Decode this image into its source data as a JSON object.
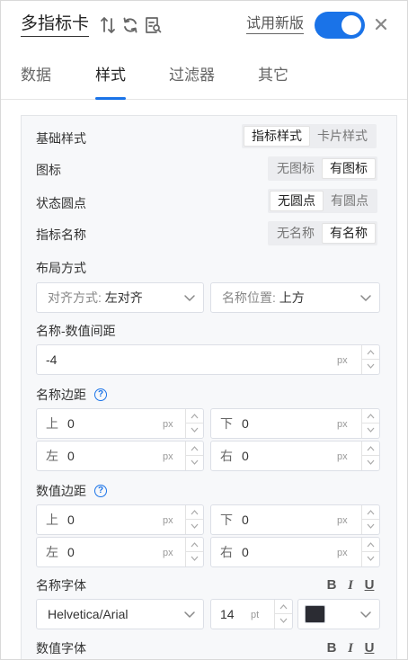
{
  "header": {
    "title": "多指标卡",
    "try_new_label": "试用新版",
    "toggle_on": true,
    "icons": [
      "sort-icon",
      "refresh-icon",
      "preview-icon",
      "close-icon"
    ]
  },
  "tabs": [
    {
      "label": "数据",
      "active": false
    },
    {
      "label": "样式",
      "active": true
    },
    {
      "label": "过滤器",
      "active": false
    },
    {
      "label": "其它",
      "active": false
    }
  ],
  "style": {
    "base_style": {
      "label": "基础样式",
      "options": [
        "指标样式",
        "卡片样式"
      ],
      "selected": "指标样式"
    },
    "icon": {
      "label": "图标",
      "options": [
        "无图标",
        "有图标"
      ],
      "selected": "有图标"
    },
    "status_dot": {
      "label": "状态圆点",
      "options": [
        "无圆点",
        "有圆点"
      ],
      "selected": "无圆点"
    },
    "metric_name": {
      "label": "指标名称",
      "options": [
        "无名称",
        "有名称"
      ],
      "selected": "有名称"
    },
    "layout": {
      "label": "布局方式",
      "align_prefix": "对齐方式:",
      "align_value": "左对齐",
      "name_pos_prefix": "名称位置:",
      "name_pos_value": "上方"
    },
    "name_value_gap": {
      "label": "名称-数值间距",
      "value": "-4",
      "unit": "px"
    },
    "name_margin": {
      "label": "名称边距",
      "top": {
        "prefix": "上",
        "value": "0",
        "unit": "px"
      },
      "bottom": {
        "prefix": "下",
        "value": "0",
        "unit": "px"
      },
      "left": {
        "prefix": "左",
        "value": "0",
        "unit": "px"
      },
      "right": {
        "prefix": "右",
        "value": "0",
        "unit": "px"
      }
    },
    "value_margin": {
      "label": "数值边距",
      "top": {
        "prefix": "上",
        "value": "0",
        "unit": "px"
      },
      "bottom": {
        "prefix": "下",
        "value": "0",
        "unit": "px"
      },
      "left": {
        "prefix": "左",
        "value": "0",
        "unit": "px"
      },
      "right": {
        "prefix": "右",
        "value": "0",
        "unit": "px"
      }
    },
    "name_font": {
      "label": "名称字体",
      "family": "Helvetica/Arial",
      "size": "14",
      "size_unit": "pt",
      "color": "#2b2c33",
      "format_buttons": [
        "B",
        "I",
        "U"
      ]
    },
    "value_font": {
      "label": "数值字体",
      "format_buttons": [
        "B",
        "I",
        "U"
      ]
    }
  },
  "colors": {
    "accent": "#1a73e8"
  }
}
